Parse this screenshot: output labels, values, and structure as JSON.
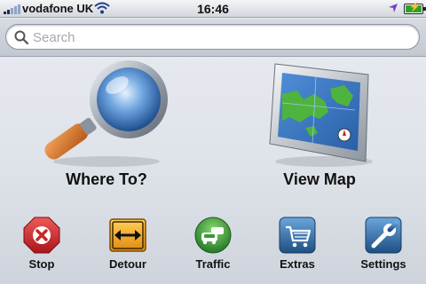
{
  "status": {
    "carrier": "vodafone UK",
    "time": "16:46",
    "signal_icon": "signal-bars-icon",
    "wifi_icon": "wifi-icon",
    "location_icon": "location-arrow-icon",
    "battery_icon": "battery-charging-icon"
  },
  "search": {
    "placeholder": "Search",
    "value": ""
  },
  "tiles": [
    {
      "label": "Where To?",
      "icon": "magnifying-glass-icon"
    },
    {
      "label": "View Map",
      "icon": "map-monitor-icon"
    }
  ],
  "toolbar": [
    {
      "label": "Stop",
      "icon": "stop-x-icon",
      "color": "#c7282b"
    },
    {
      "label": "Detour",
      "icon": "detour-arrows-icon",
      "color": "#f1a81b"
    },
    {
      "label": "Traffic",
      "icon": "traffic-car-icon",
      "color": "#3a9a3c"
    },
    {
      "label": "Extras",
      "icon": "shopping-cart-icon",
      "color": "#2e6a9e"
    },
    {
      "label": "Settings",
      "icon": "wrench-icon",
      "color": "#2e6a9e"
    }
  ]
}
